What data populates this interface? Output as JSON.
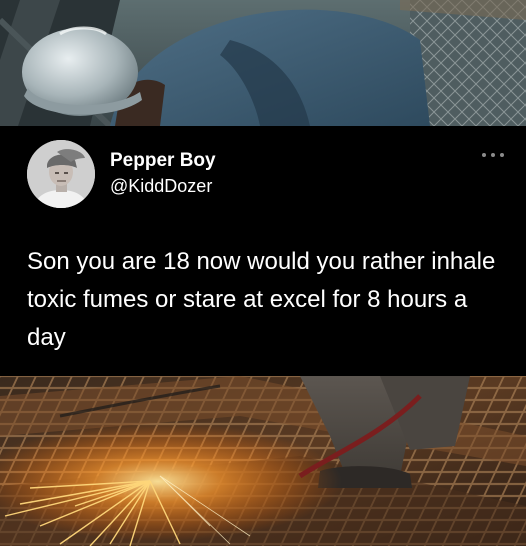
{
  "tweet": {
    "display_name": "Pepper Boy",
    "handle": "@KiddDozer",
    "text": "Son you are 18 now would you rather inhale toxic fumes or stare at excel for 8 hours a day",
    "more_icon": "more-horizontal-icon"
  },
  "colors": {
    "card_background": "#000000",
    "text": "#ffffff",
    "icon_gray": "#8b8b8b"
  }
}
